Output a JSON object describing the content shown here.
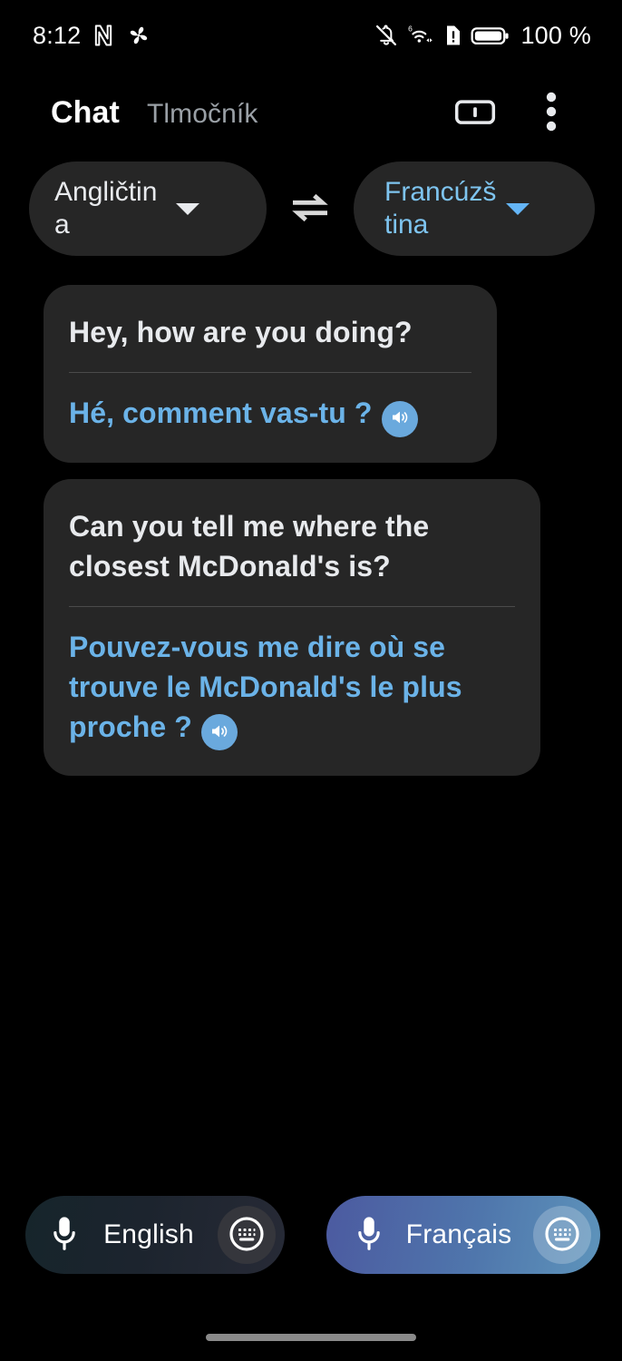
{
  "status_bar": {
    "time": "8:12",
    "battery_percent": "100 %",
    "icons": [
      "nfc-icon",
      "pinwheel-icon",
      "notifications-muted-icon",
      "wifi-6-icon",
      "sim-alert-icon",
      "battery-full-icon"
    ],
    "wifi_generation": "6"
  },
  "header": {
    "tab_active": "Chat",
    "tab_inactive": "Tlmočník",
    "actions": [
      "transcribe-view-icon",
      "overflow-menu-icon"
    ]
  },
  "language_bar": {
    "source_language": "Angličtina",
    "target_language": "Francúzština",
    "swap_icon": "swap-horizontal-icon",
    "source_color": "#e8eaed",
    "target_color": "#7ec4ef"
  },
  "conversation": {
    "messages": [
      {
        "source_text": "Hey, how are you doing?",
        "translated_text": "Hé, comment vas-tu ?",
        "speak_icon": "speaker-icon"
      },
      {
        "source_text": "Can you tell me where the closest McDonald's is?",
        "translated_text": "Pouvez-vous me dire où se trouve le McDonald's le plus proche ?",
        "speak_icon": "speaker-icon"
      }
    ]
  },
  "mic_bar": {
    "source_button_label": "English",
    "target_button_label": "Français",
    "mic_icon": "microphone-icon",
    "keyboard_icon": "keyboard-icon"
  },
  "colors": {
    "background": "#000000",
    "surface": "#262626",
    "accent_blue": "#6bb3e8",
    "speaker_blue": "#6aa9dd",
    "muted_text": "#9aa0a6"
  }
}
